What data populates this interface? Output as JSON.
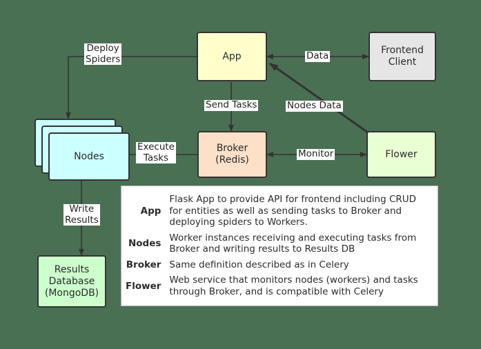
{
  "diagram": {
    "background_color": "#4a7053",
    "nodes": {
      "app": {
        "label": "App",
        "color": "#ffffcc"
      },
      "frontend": {
        "label": "Frontend\nClient",
        "color": "#e6e6e6"
      },
      "nodes_stack": {
        "label": "Nodes",
        "color": "#ccffff",
        "card_count": 3
      },
      "broker": {
        "label": "Broker\n(Redis)",
        "color": "#fce0c8"
      },
      "flower": {
        "label": "Flower",
        "color": "#e9ffd4"
      },
      "results_db": {
        "label": "Results\nDatabase\n(MongoDB)",
        "color": "#ccffcc"
      }
    },
    "edges": {
      "deploy_spiders": {
        "label": "Deploy\nSpiders",
        "from": "app",
        "to": "nodes_stack"
      },
      "data": {
        "label": "Data",
        "from": "app",
        "to": "frontend",
        "bidirectional": true
      },
      "send_tasks": {
        "label": "Send Tasks",
        "from": "app",
        "to": "broker"
      },
      "nodes_data": {
        "label": "Nodes Data",
        "from": "flower",
        "to": "app"
      },
      "execute_tasks": {
        "label": "Execute\nTasks",
        "from": "broker",
        "to": "nodes_stack"
      },
      "monitor": {
        "label": "Monitor",
        "from": "flower",
        "to": "broker",
        "bidirectional": true
      },
      "write_results": {
        "label": "Write\nResults",
        "from": "nodes_stack",
        "to": "results_db"
      }
    }
  },
  "legend": {
    "rows": [
      {
        "term": "App",
        "description": "Flask App to provide API for frontend including CRUD for entities as well as sending tasks to Broker and deploying spiders to Workers."
      },
      {
        "term": "Nodes",
        "description": "Worker instances receiving and executing tasks from Broker and writing results to Results DB"
      },
      {
        "term": "Broker",
        "description": "Same definition described as in Celery"
      },
      {
        "term": "Flower",
        "description": "Web service that monitors nodes (workers) and tasks through Broker, and is compatible with Celery"
      }
    ]
  }
}
